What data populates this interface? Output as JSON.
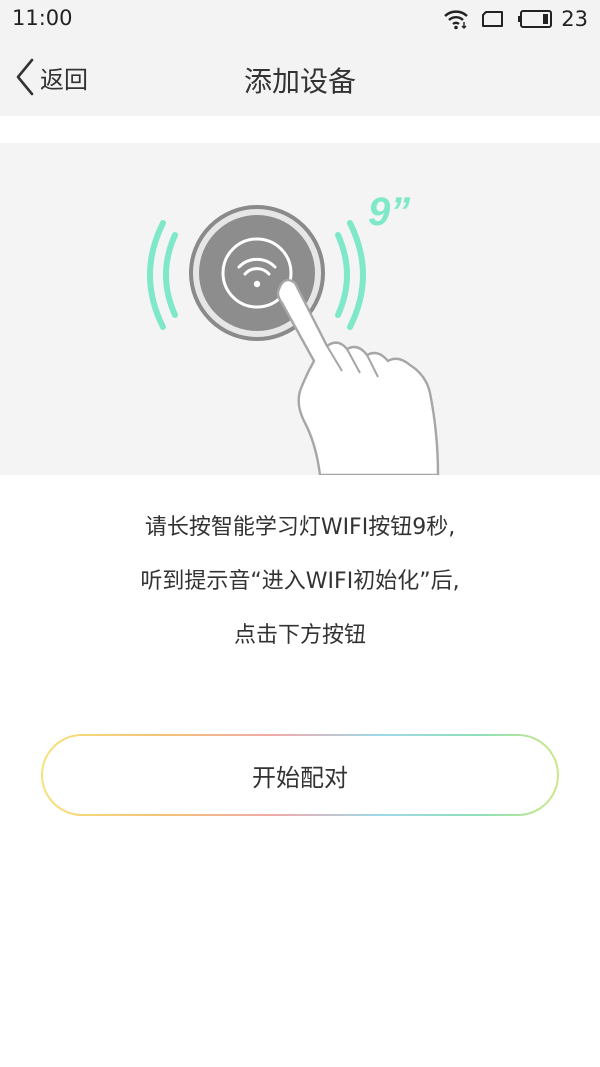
{
  "status_bar": {
    "time": "11:00",
    "battery_level": "23",
    "icons": [
      "wifi-icon",
      "screen-rotation-icon",
      "battery-icon"
    ]
  },
  "header": {
    "back_label": "返回",
    "title": "添加设备"
  },
  "illustration": {
    "countdown": "9”",
    "accent_color": "#7fe8c8",
    "icons": [
      "wifi-button-icon",
      "pressing-finger-icon"
    ]
  },
  "instructions": {
    "lines": [
      "请长按智能学习灯WIFI按钮9秒,",
      "听到提示音“进入WIFI初始化”后,",
      "点击下方按钮"
    ]
  },
  "start_button": {
    "label": "开始配对"
  }
}
